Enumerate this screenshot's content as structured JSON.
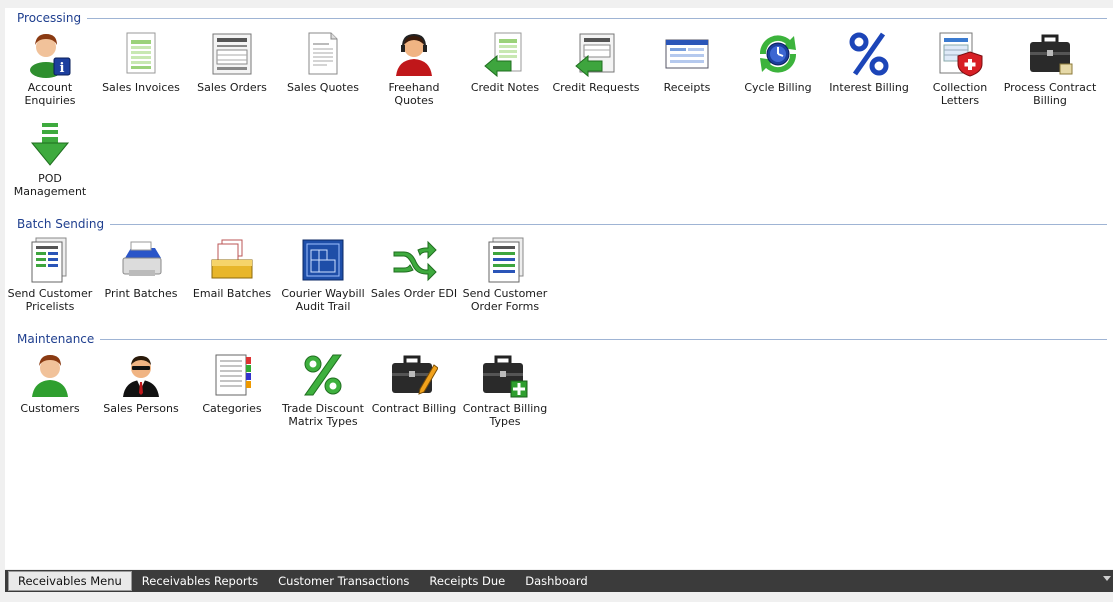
{
  "sections": {
    "processing": {
      "title": "Processing",
      "items": {
        "account_enquiries": "Account\nEnquiries",
        "sales_invoices": "Sales Invoices",
        "sales_orders": "Sales Orders",
        "sales_quotes": "Sales Quotes",
        "freehand_quotes": "Freehand\nQuotes",
        "credit_notes": "Credit Notes",
        "credit_requests": "Credit Requests",
        "receipts": "Receipts",
        "cycle_billing": "Cycle Billing",
        "interest_billing": "Interest Billing",
        "collection_letters": "Collection\nLetters",
        "process_contract_billing": "Process Contract\nBilling",
        "pod_management": "POD\nManagement"
      }
    },
    "batch_sending": {
      "title": "Batch Sending",
      "items": {
        "send_customer_pricelists": "Send Customer\nPricelists",
        "print_batches": "Print Batches",
        "email_batches": "Email Batches",
        "courier_waybill_audit_trail": "Courier Waybill\nAudit Trail",
        "sales_order_edi": "Sales Order EDI",
        "send_customer_order_forms": "Send Customer\nOrder Forms"
      }
    },
    "maintenance": {
      "title": "Maintenance",
      "items": {
        "customers": "Customers",
        "sales_persons": "Sales Persons",
        "categories": "Categories",
        "trade_discount_matrix_types": "Trade Discount\nMatrix Types",
        "contract_billing": "Contract Billing",
        "contract_billing_types": "Contract Billing\nTypes"
      }
    }
  },
  "tabs": {
    "receivables_menu": "Receivables Menu",
    "receivables_reports": "Receivables Reports",
    "customer_transactions": "Customer Transactions",
    "receipts_due": "Receipts Due",
    "dashboard": "Dashboard"
  },
  "colors": {
    "section_title": "#1f3f8f",
    "tab_bar": "#3b3b3b",
    "active_tab": "#e9e9e9"
  }
}
